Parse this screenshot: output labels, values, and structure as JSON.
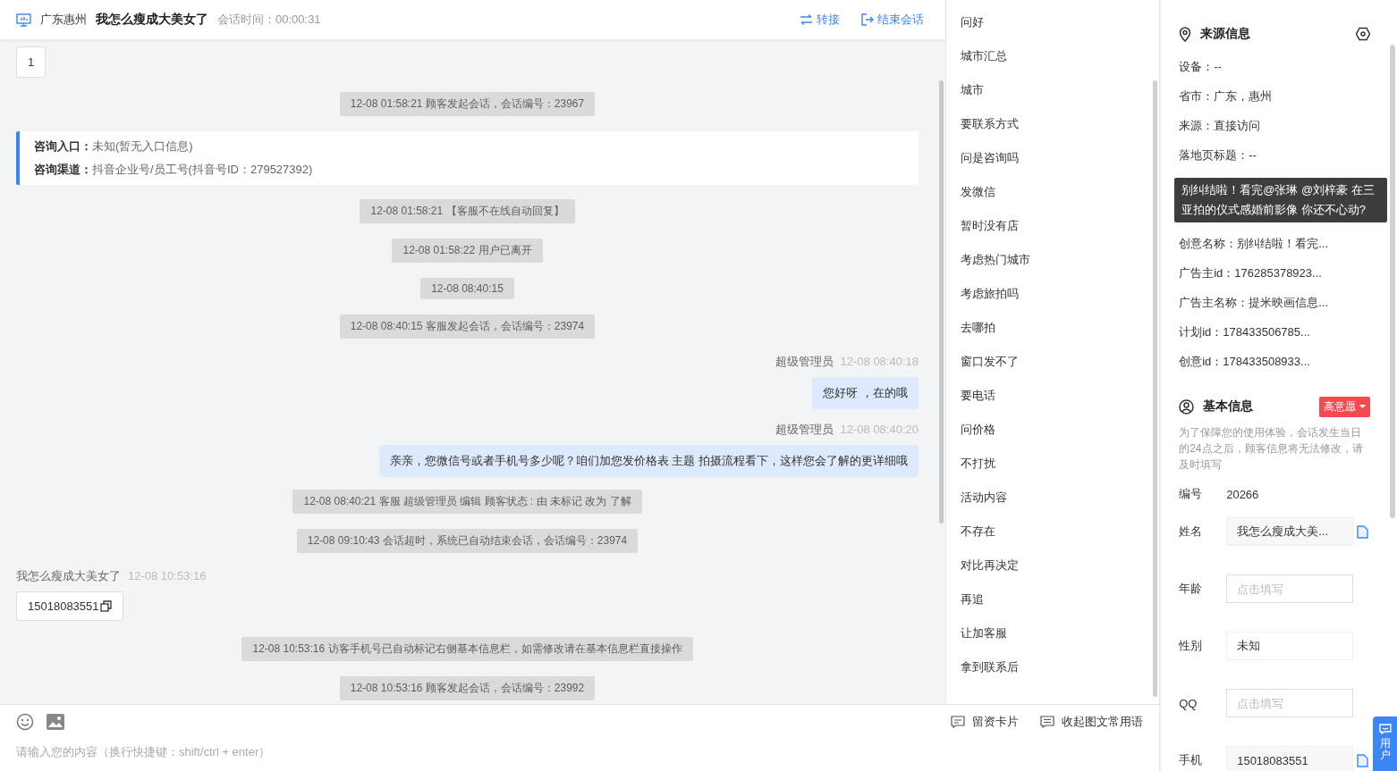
{
  "header": {
    "location": "广东惠州",
    "visitor": "我怎么瘦成大美女了",
    "duration": "会话时间：00:00:31",
    "actions": [
      {
        "kind": "transfer",
        "label": "转接"
      },
      {
        "kind": "end",
        "label": "结束会话"
      }
    ]
  },
  "page_tab": "1",
  "messages": [
    {
      "kind": "system",
      "text": "12-08 01:58:21 顾客发起会话，会话编号：23967"
    },
    {
      "kind": "source",
      "rows": [
        {
          "label": "咨询入口：",
          "value": "未知(暂无入口信息)"
        },
        {
          "label": "咨询渠道：",
          "value": "抖音企业号/员工号(抖音号ID：279527392)"
        }
      ]
    },
    {
      "kind": "system",
      "text": "12-08 01:58:21 【客服不在线自动回复】"
    },
    {
      "kind": "system",
      "text": "12-08 01:58:22 用户已离开"
    },
    {
      "kind": "system",
      "text": "12-08 08:40:15"
    },
    {
      "kind": "system",
      "text": "12-08 08:40:15 客服发起会话，会话编号：23974"
    },
    {
      "kind": "agent",
      "sender": "超级管理员",
      "time": "12-08 08:40:18",
      "text": "您好呀 ，在的哦"
    },
    {
      "kind": "agent",
      "sender": "超级管理员",
      "time": "12-08 08:40:20",
      "text": "亲亲，您微信号或者手机号多少呢？咱们加您发价格表 主题 拍摄流程看下，这样您会了解的更详细哦"
    },
    {
      "kind": "system",
      "text": "12-08 08:40:21 客服 超级管理员 编辑 顾客状态 : 由 未标记 改为 了解"
    },
    {
      "kind": "system",
      "text": "12-08 09:10:43 会话超时，系统已自动结束会话，会话编号：23974"
    },
    {
      "kind": "visitor",
      "sender": "我怎么瘦成大美女了",
      "time": "12-08 10:53:16",
      "text": "15018083551"
    },
    {
      "kind": "system",
      "text": "12-08 10:53:16 访客手机号已自动标记右侧基本信息栏，如需修改请在基本信息栏直接操作"
    },
    {
      "kind": "system",
      "text": "12-08 10:53:16 顾客发起会话，会话编号：23992"
    }
  ],
  "phrases": [
    "问好",
    "城市汇总",
    "城市",
    "要联系方式",
    "问是咨询吗",
    "发微信",
    "暂时没有店",
    "考虑热门城市",
    "考虑旅拍吗",
    "去哪拍",
    "窗口发不了",
    "要电话",
    "问价格",
    "不打扰",
    "活动内容",
    "不存在",
    "对比再决定",
    "再追",
    "让加客服",
    "拿到联系后"
  ],
  "composer": {
    "tools": [
      {
        "kind": "card",
        "label": "留资卡片"
      },
      {
        "kind": "collapse",
        "label": "收起图文常用语"
      }
    ],
    "placeholder": "请输入您的内容（换行快捷键：shift/ctrl + enter）"
  },
  "source_info": {
    "title": "来源信息",
    "rows_before": [
      "设备：--",
      "省市：广东，惠州",
      "来源：直接访问",
      "落地页标题：--"
    ],
    "tooltip": "别纠结啦！看完@张琳 @刘梓豪 在三亚拍的仪式感婚前影像 你还不心动?",
    "rows_after": [
      "创意名称：别纠结啦！看完...",
      "广告主id：176285378923...",
      "广告主名称：提米映画信息...",
      "计划id：178433506785...",
      "创意id：178433508933..."
    ]
  },
  "basic_info": {
    "title": "基本信息",
    "intent_tag": "高意愿",
    "notice": "为了保障您的使用体验，会话发生当日的24点之后，顾客信息将无法修改，请及时填写",
    "fields": [
      {
        "label": "编号",
        "kind": "text",
        "value": "20266"
      },
      {
        "label": "姓名",
        "kind": "readonly",
        "value": "我怎么瘦成大美...",
        "copy": true
      },
      {
        "label": "年龄",
        "kind": "input",
        "placeholder": "点击填写"
      },
      {
        "label": "性别",
        "kind": "select",
        "value": "未知"
      },
      {
        "label": "QQ",
        "kind": "input",
        "placeholder": "点击填写"
      },
      {
        "label": "手机",
        "kind": "readonly",
        "value": "15018083551",
        "copy": true
      }
    ]
  },
  "float_button": "用户"
}
